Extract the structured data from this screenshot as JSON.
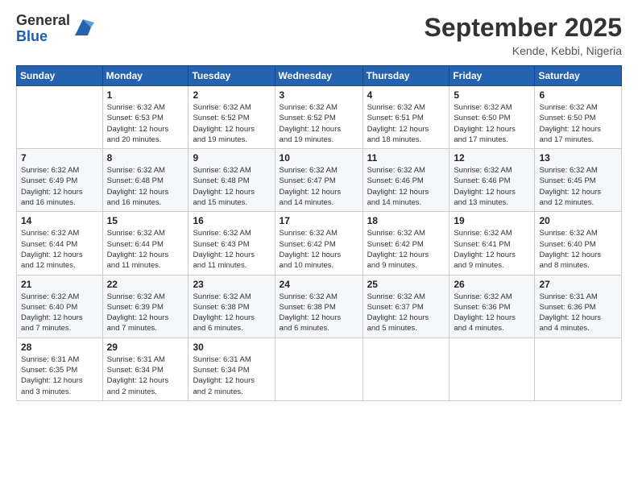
{
  "logo": {
    "general": "General",
    "blue": "Blue"
  },
  "header": {
    "month": "September 2025",
    "location": "Kende, Kebbi, Nigeria"
  },
  "weekdays": [
    "Sunday",
    "Monday",
    "Tuesday",
    "Wednesday",
    "Thursday",
    "Friday",
    "Saturday"
  ],
  "weeks": [
    [
      {
        "day": "",
        "info": ""
      },
      {
        "day": "1",
        "info": "Sunrise: 6:32 AM\nSunset: 6:53 PM\nDaylight: 12 hours\nand 20 minutes."
      },
      {
        "day": "2",
        "info": "Sunrise: 6:32 AM\nSunset: 6:52 PM\nDaylight: 12 hours\nand 19 minutes."
      },
      {
        "day": "3",
        "info": "Sunrise: 6:32 AM\nSunset: 6:52 PM\nDaylight: 12 hours\nand 19 minutes."
      },
      {
        "day": "4",
        "info": "Sunrise: 6:32 AM\nSunset: 6:51 PM\nDaylight: 12 hours\nand 18 minutes."
      },
      {
        "day": "5",
        "info": "Sunrise: 6:32 AM\nSunset: 6:50 PM\nDaylight: 12 hours\nand 17 minutes."
      },
      {
        "day": "6",
        "info": "Sunrise: 6:32 AM\nSunset: 6:50 PM\nDaylight: 12 hours\nand 17 minutes."
      }
    ],
    [
      {
        "day": "7",
        "info": "Sunrise: 6:32 AM\nSunset: 6:49 PM\nDaylight: 12 hours\nand 16 minutes."
      },
      {
        "day": "8",
        "info": "Sunrise: 6:32 AM\nSunset: 6:48 PM\nDaylight: 12 hours\nand 16 minutes."
      },
      {
        "day": "9",
        "info": "Sunrise: 6:32 AM\nSunset: 6:48 PM\nDaylight: 12 hours\nand 15 minutes."
      },
      {
        "day": "10",
        "info": "Sunrise: 6:32 AM\nSunset: 6:47 PM\nDaylight: 12 hours\nand 14 minutes."
      },
      {
        "day": "11",
        "info": "Sunrise: 6:32 AM\nSunset: 6:46 PM\nDaylight: 12 hours\nand 14 minutes."
      },
      {
        "day": "12",
        "info": "Sunrise: 6:32 AM\nSunset: 6:46 PM\nDaylight: 12 hours\nand 13 minutes."
      },
      {
        "day": "13",
        "info": "Sunrise: 6:32 AM\nSunset: 6:45 PM\nDaylight: 12 hours\nand 12 minutes."
      }
    ],
    [
      {
        "day": "14",
        "info": "Sunrise: 6:32 AM\nSunset: 6:44 PM\nDaylight: 12 hours\nand 12 minutes."
      },
      {
        "day": "15",
        "info": "Sunrise: 6:32 AM\nSunset: 6:44 PM\nDaylight: 12 hours\nand 11 minutes."
      },
      {
        "day": "16",
        "info": "Sunrise: 6:32 AM\nSunset: 6:43 PM\nDaylight: 12 hours\nand 11 minutes."
      },
      {
        "day": "17",
        "info": "Sunrise: 6:32 AM\nSunset: 6:42 PM\nDaylight: 12 hours\nand 10 minutes."
      },
      {
        "day": "18",
        "info": "Sunrise: 6:32 AM\nSunset: 6:42 PM\nDaylight: 12 hours\nand 9 minutes."
      },
      {
        "day": "19",
        "info": "Sunrise: 6:32 AM\nSunset: 6:41 PM\nDaylight: 12 hours\nand 9 minutes."
      },
      {
        "day": "20",
        "info": "Sunrise: 6:32 AM\nSunset: 6:40 PM\nDaylight: 12 hours\nand 8 minutes."
      }
    ],
    [
      {
        "day": "21",
        "info": "Sunrise: 6:32 AM\nSunset: 6:40 PM\nDaylight: 12 hours\nand 7 minutes."
      },
      {
        "day": "22",
        "info": "Sunrise: 6:32 AM\nSunset: 6:39 PM\nDaylight: 12 hours\nand 7 minutes."
      },
      {
        "day": "23",
        "info": "Sunrise: 6:32 AM\nSunset: 6:38 PM\nDaylight: 12 hours\nand 6 minutes."
      },
      {
        "day": "24",
        "info": "Sunrise: 6:32 AM\nSunset: 6:38 PM\nDaylight: 12 hours\nand 6 minutes."
      },
      {
        "day": "25",
        "info": "Sunrise: 6:32 AM\nSunset: 6:37 PM\nDaylight: 12 hours\nand 5 minutes."
      },
      {
        "day": "26",
        "info": "Sunrise: 6:32 AM\nSunset: 6:36 PM\nDaylight: 12 hours\nand 4 minutes."
      },
      {
        "day": "27",
        "info": "Sunrise: 6:31 AM\nSunset: 6:36 PM\nDaylight: 12 hours\nand 4 minutes."
      }
    ],
    [
      {
        "day": "28",
        "info": "Sunrise: 6:31 AM\nSunset: 6:35 PM\nDaylight: 12 hours\nand 3 minutes."
      },
      {
        "day": "29",
        "info": "Sunrise: 6:31 AM\nSunset: 6:34 PM\nDaylight: 12 hours\nand 2 minutes."
      },
      {
        "day": "30",
        "info": "Sunrise: 6:31 AM\nSunset: 6:34 PM\nDaylight: 12 hours\nand 2 minutes."
      },
      {
        "day": "",
        "info": ""
      },
      {
        "day": "",
        "info": ""
      },
      {
        "day": "",
        "info": ""
      },
      {
        "day": "",
        "info": ""
      }
    ]
  ]
}
